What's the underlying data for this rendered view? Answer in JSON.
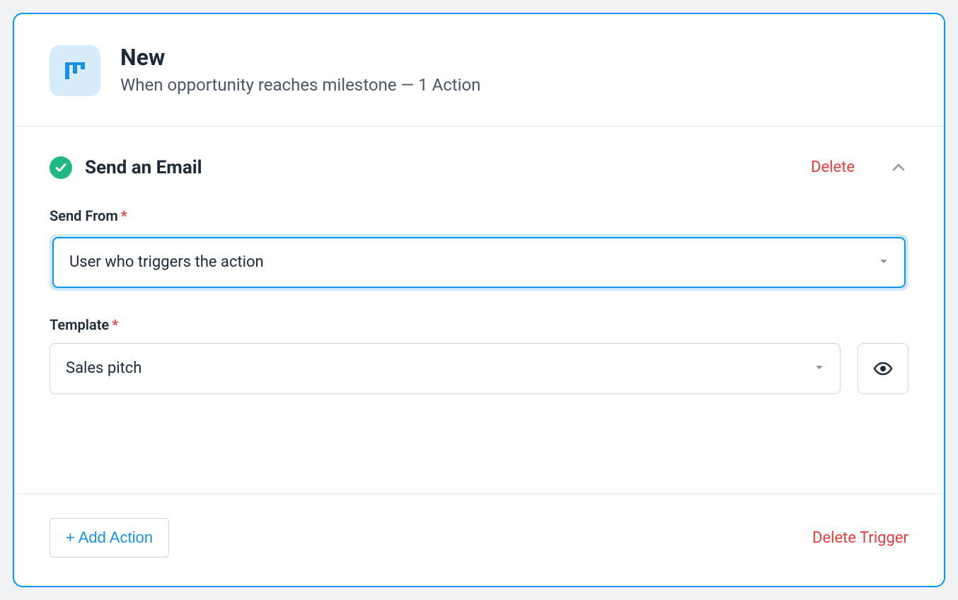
{
  "header": {
    "title": "New",
    "subtitle": "When opportunity reaches milestone — 1 Action"
  },
  "action": {
    "title": "Send an Email",
    "delete_label": "Delete",
    "fields": {
      "send_from_label": "Send From",
      "send_from_value": "User who triggers the action",
      "template_label": "Template",
      "template_value": "Sales pitch"
    }
  },
  "footer": {
    "add_action_label": "+ Add Action",
    "delete_trigger_label": "Delete Trigger"
  }
}
